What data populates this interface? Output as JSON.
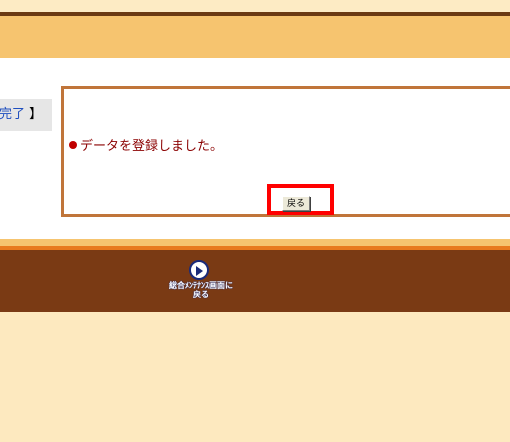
{
  "header": {},
  "page": {
    "title_tab_visible": "完了",
    "title_tab_close": "】"
  },
  "message": {
    "text": "データを登録しました。"
  },
  "actions": {
    "back_label": "戻る"
  },
  "footer": {
    "menu_link_line1": "総合ﾒﾝﾃﾅﾝｽ画面に",
    "menu_link_line2": "戻る"
  },
  "colors": {
    "accent_band": "#f6c46f",
    "dark_brown": "#7a3a14",
    "message_border": "#c0753a",
    "message_text": "#8b0000",
    "highlight": "#ff0000"
  }
}
